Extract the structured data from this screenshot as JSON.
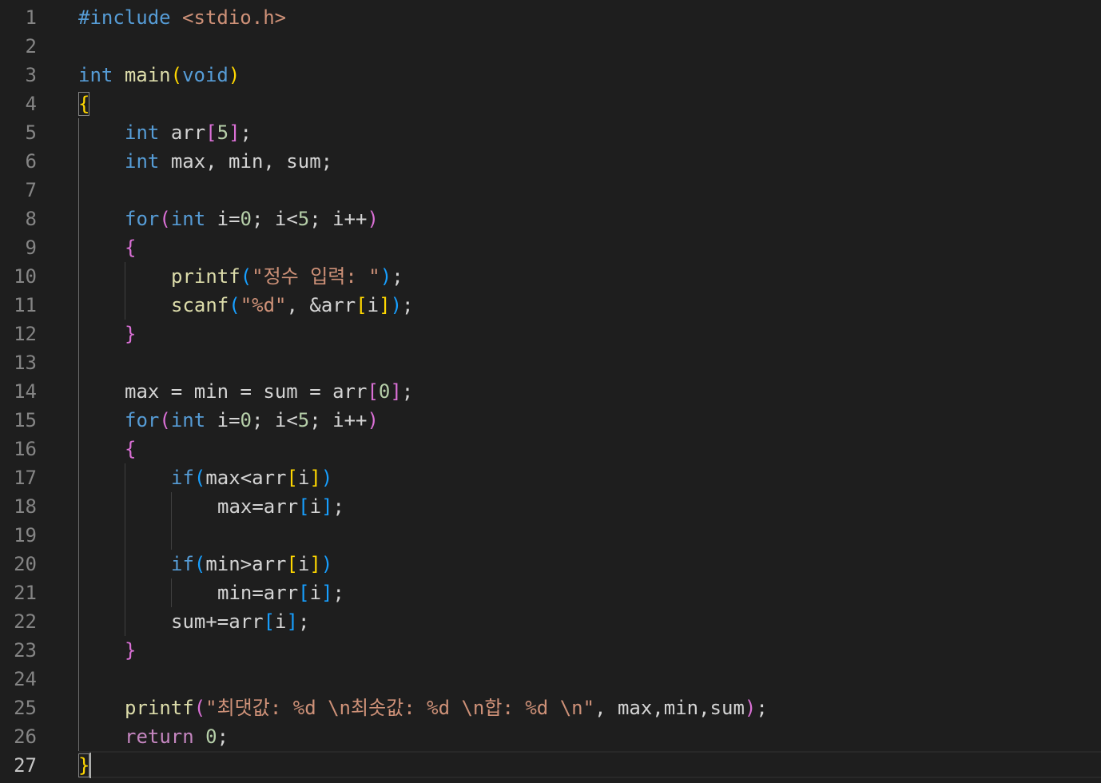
{
  "editor": {
    "cursor_line": 27,
    "line_numbers": [
      "1",
      "2",
      "3",
      "4",
      "5",
      "6",
      "7",
      "8",
      "9",
      "10",
      "11",
      "12",
      "13",
      "14",
      "15",
      "16",
      "17",
      "18",
      "19",
      "20",
      "21",
      "22",
      "23",
      "24",
      "25",
      "26",
      "27"
    ],
    "tokens": {
      "l1_directive": "#include",
      "l1_header": "<stdio.h>",
      "l3_type": "int",
      "l3_name": "main",
      "l3_open": "(",
      "l3_void": "void",
      "l3_close": ")",
      "l4_brace": "{",
      "l5_type": "int",
      "l5_name": "arr",
      "l5_lb": "[",
      "l5_num": "5",
      "l5_rb": "]",
      "l5_semi": ";",
      "l6_type": "int",
      "l6_vars": "max, min, sum;",
      "l8_for": "for",
      "l8_open": "(",
      "l8_type": "int",
      "l8_a": "i=",
      "l8_n0": "0",
      "l8_b": "; i<",
      "l8_n5": "5",
      "l8_c": "; i++",
      "l8_close": ")",
      "l9_brace": "{",
      "l10_fn": "printf",
      "l10_open": "(",
      "l10_str": "\"정수 입력: \"",
      "l10_close": ")",
      "l10_semi": ";",
      "l11_fn": "scanf",
      "l11_open": "(",
      "l11_str": "\"%d\"",
      "l11_mid": ", &arr",
      "l11_lb": "[",
      "l11_i": "i",
      "l11_rb": "]",
      "l11_close": ")",
      "l11_semi": ";",
      "l12_brace": "}",
      "l14_a": "max = min = sum = arr",
      "l14_lb": "[",
      "l14_n0": "0",
      "l14_rb": "]",
      "l14_semi": ";",
      "l15_for": "for",
      "l15_open": "(",
      "l15_type": "int",
      "l15_a": "i=",
      "l15_n0": "0",
      "l15_b": "; i<",
      "l15_n5": "5",
      "l15_c": "; i++",
      "l15_close": ")",
      "l16_brace": "{",
      "l17_if": "if",
      "l17_open": "(",
      "l17_a": "max<arr",
      "l17_lb": "[",
      "l17_i": "i",
      "l17_rb": "]",
      "l17_close": ")",
      "l18_a": "max=arr",
      "l18_lb": "[",
      "l18_i": "i",
      "l18_rb": "]",
      "l18_semi": ";",
      "l20_if": "if",
      "l20_open": "(",
      "l20_a": "min>arr",
      "l20_lb": "[",
      "l20_i": "i",
      "l20_rb": "]",
      "l20_close": ")",
      "l21_a": "min=arr",
      "l21_lb": "[",
      "l21_i": "i",
      "l21_rb": "]",
      "l21_semi": ";",
      "l22_a": "sum+=arr",
      "l22_lb": "[",
      "l22_i": "i",
      "l22_rb": "]",
      "l22_semi": ";",
      "l23_brace": "}",
      "l25_fn": "printf",
      "l25_open": "(",
      "l25_str": "\"최댓값: %d \\n최솟값: %d \\n합: %d \\n\"",
      "l25_args": ", max,min,sum",
      "l25_close": ")",
      "l25_semi": ";",
      "l26_ret": "return",
      "l26_num": "0",
      "l26_semi": ";",
      "l27_brace": "}"
    }
  }
}
